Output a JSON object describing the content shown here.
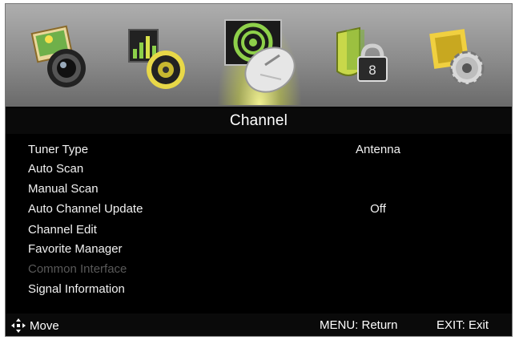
{
  "icon_bar": {
    "icons": [
      "picture-icon",
      "sound-icon",
      "channel-satellite-dish-icon",
      "lock-icon",
      "setup-gear-icon"
    ],
    "selected_index": 2
  },
  "title": "Channel",
  "menu": [
    {
      "label": "Tuner Type",
      "value": "Antenna",
      "enabled": true
    },
    {
      "label": "Auto Scan",
      "value": "",
      "enabled": true
    },
    {
      "label": "Manual Scan",
      "value": "",
      "enabled": true
    },
    {
      "label": "Auto Channel Update",
      "value": "Off",
      "enabled": true
    },
    {
      "label": "Channel Edit",
      "value": "",
      "enabled": true
    },
    {
      "label": "Favorite Manager",
      "value": "",
      "enabled": true
    },
    {
      "label": "Common Interface",
      "value": "",
      "enabled": false
    },
    {
      "label": "Signal Information",
      "value": "",
      "enabled": true
    }
  ],
  "footer": {
    "move": "Move",
    "menu_return": "MENU: Return",
    "exit": "EXIT: Exit"
  },
  "colors": {
    "background": "#000000",
    "text": "#f2f2f2",
    "disabled_text": "#595959",
    "selection_glow": "#e6f04a"
  }
}
